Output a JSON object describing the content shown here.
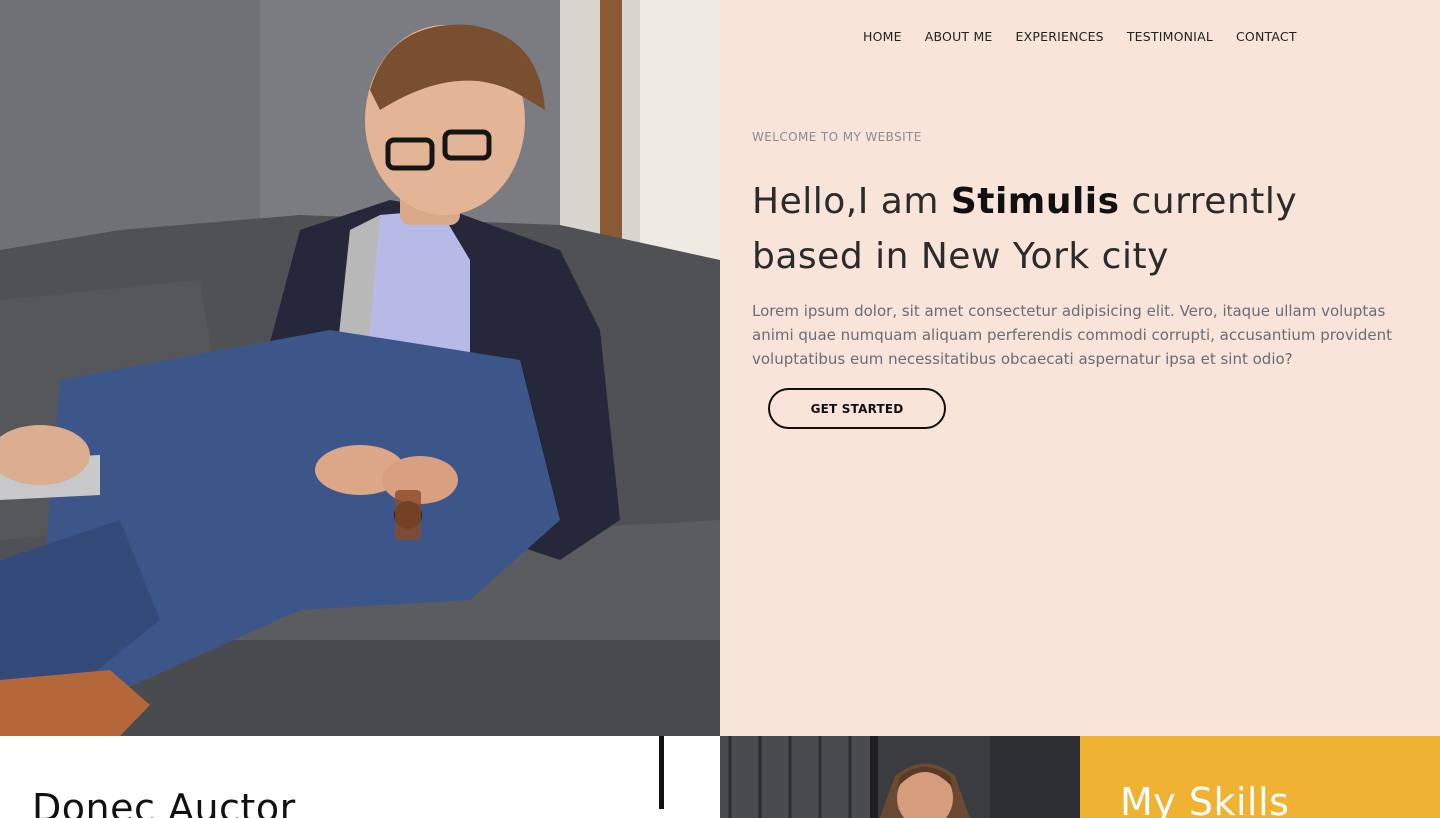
{
  "nav": {
    "items": [
      {
        "label": "HOME"
      },
      {
        "label": "ABOUT ME"
      },
      {
        "label": "EXPERIENCES"
      },
      {
        "label": "TESTIMONIAL"
      },
      {
        "label": "CONTACT"
      }
    ]
  },
  "hero": {
    "eyebrow": "WELCOME TO MY WEBSITE",
    "headline_pre": "Hello,I am ",
    "headline_name": "Stimulis",
    "headline_post": " currently based in New York city",
    "lead": "Lorem ipsum dolor, sit amet consectetur adipisicing elit. Vero, itaque ullam voluptas animi quae numquam aliquam perferendis commodi corrupti, accusantium provident voluptatibus eum necessitatibus obcaecati aspernatur ipsa et sint odio?",
    "cta_label": "GET STARTED"
  },
  "about": {
    "title": "Donec Auctor"
  },
  "skills": {
    "title": "My Skills"
  },
  "colors": {
    "hero_bg": "#f8e4d8",
    "skills_bg": "#f0b233",
    "text_dark": "#111111"
  }
}
